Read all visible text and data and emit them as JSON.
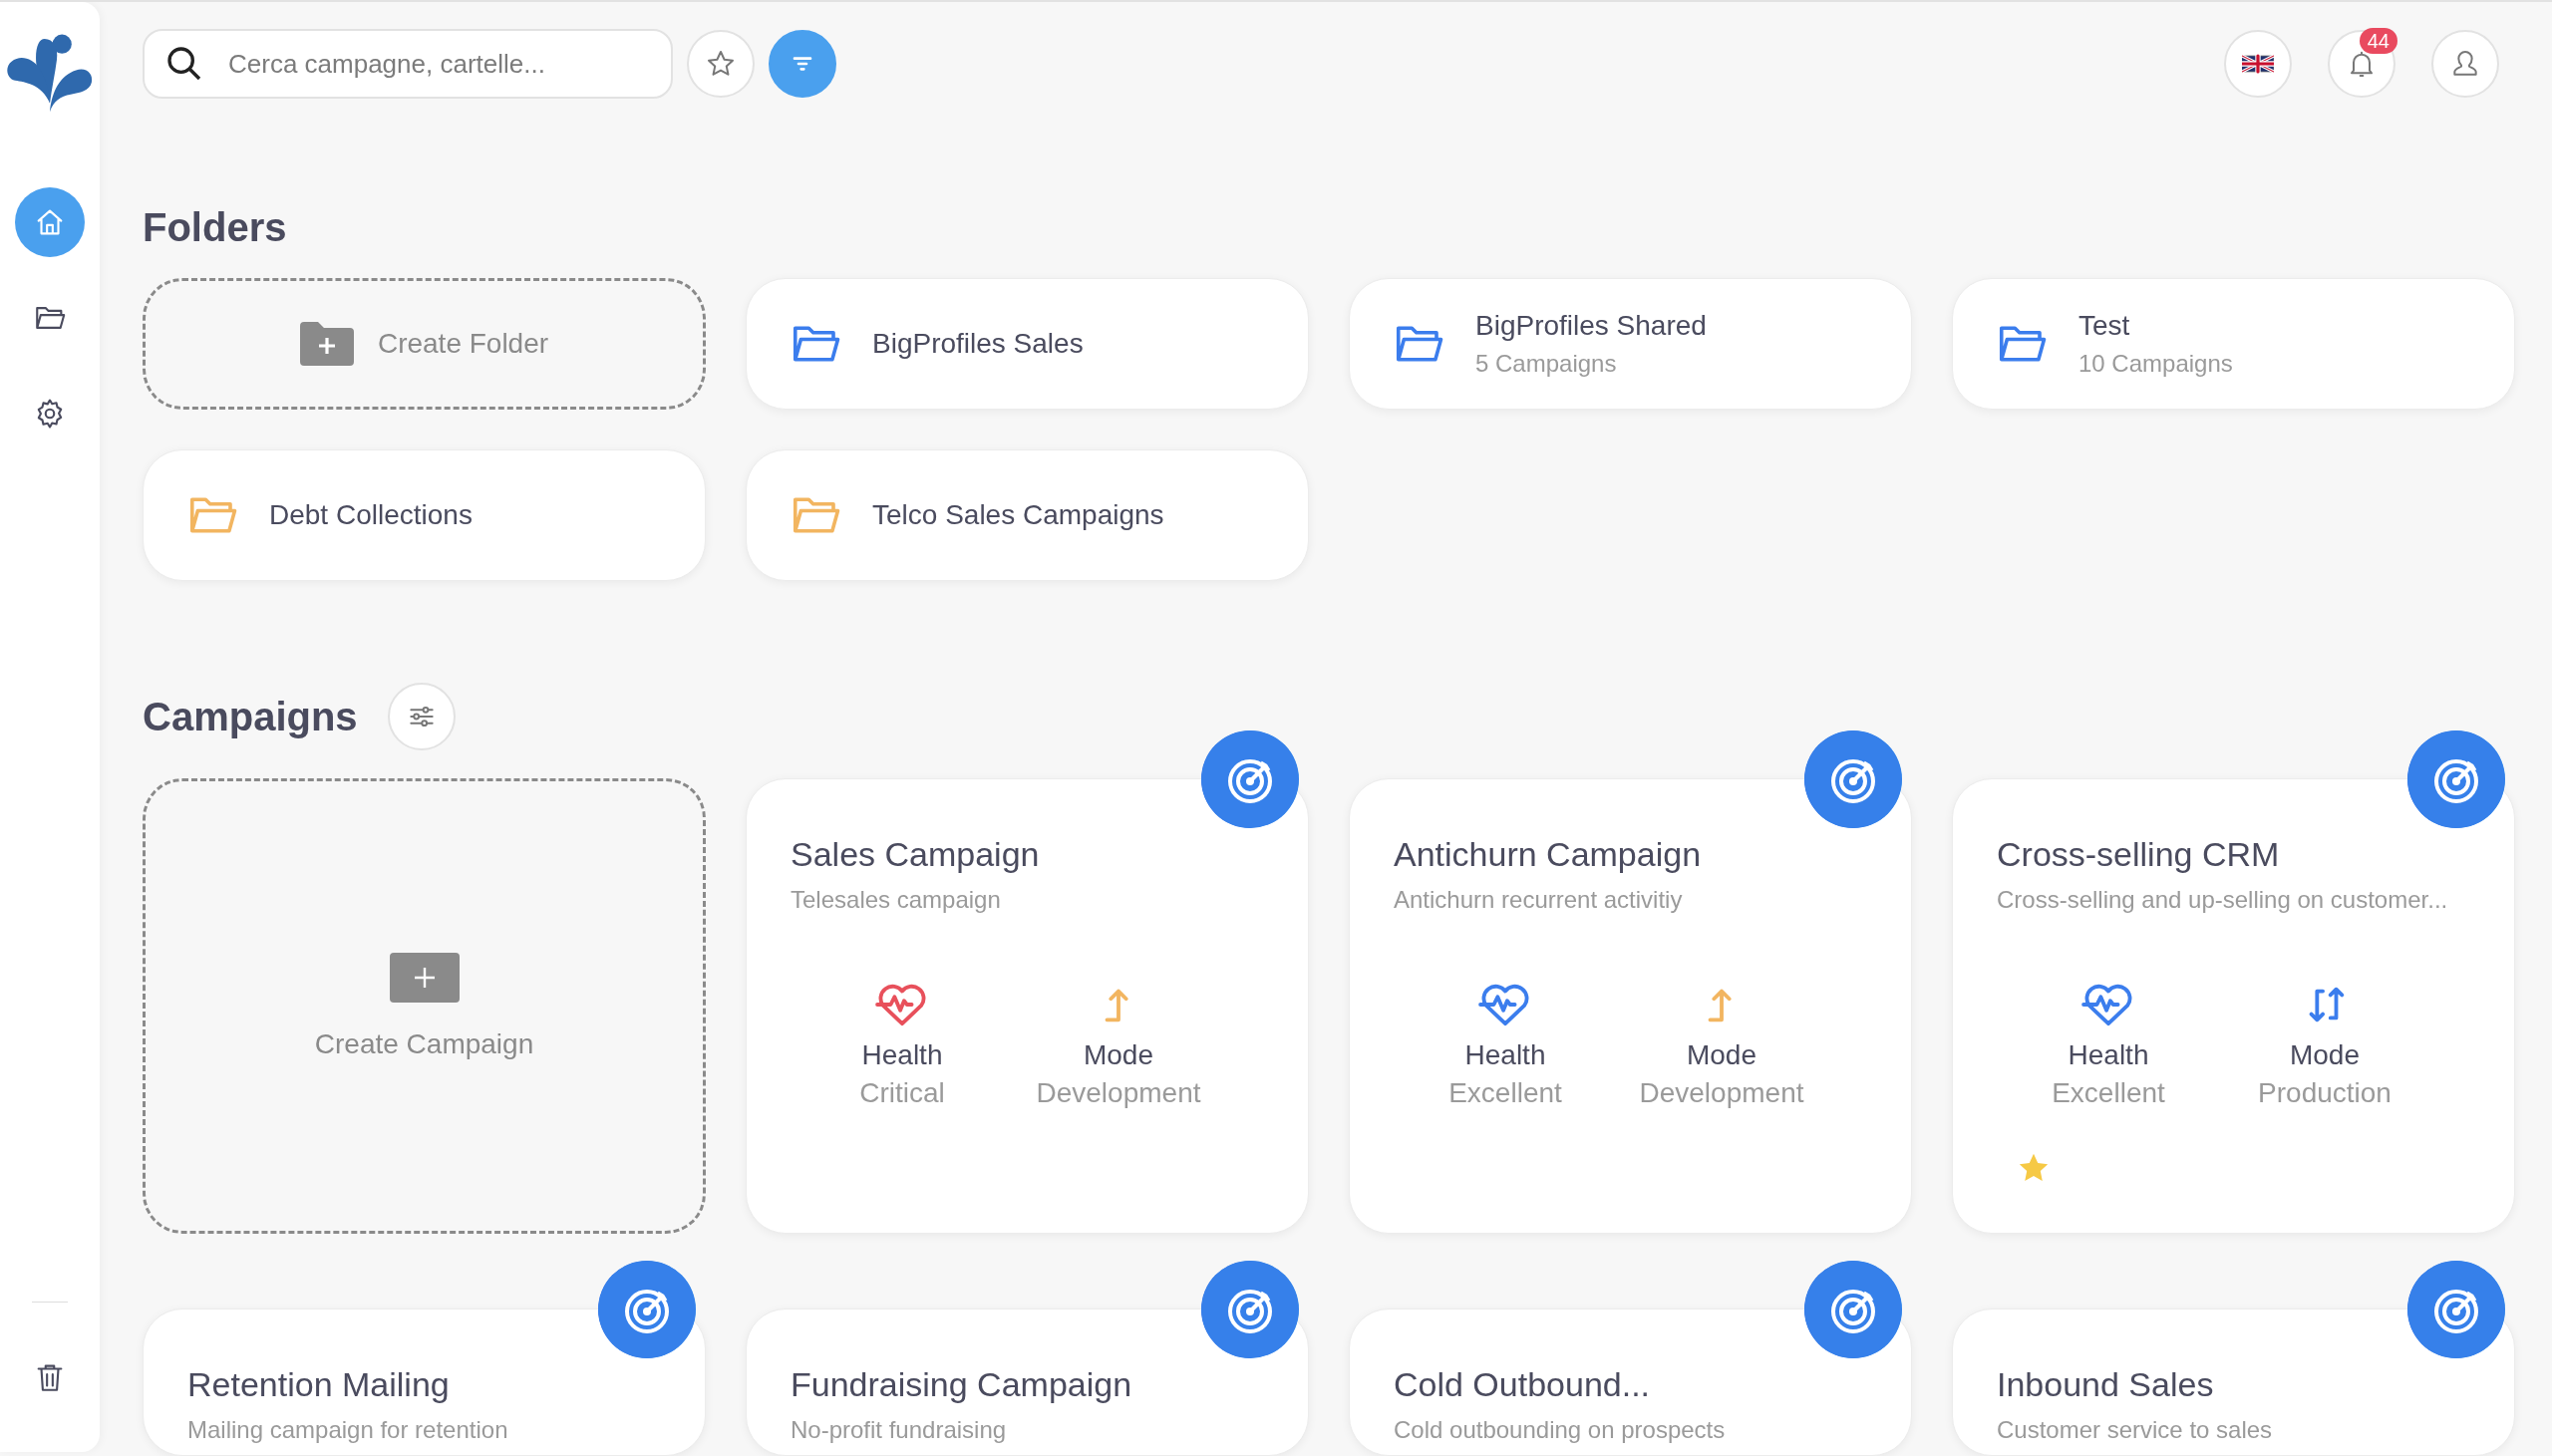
{
  "sidebar": {
    "items": [
      {
        "kind": "home",
        "selected": true
      },
      {
        "kind": "folders",
        "selected": false
      },
      {
        "kind": "settings",
        "selected": false
      },
      {
        "kind": "trash",
        "selected": false
      }
    ]
  },
  "search": {
    "placeholder": "Cerca campagne, cartelle..."
  },
  "toolbar": [
    {
      "kind": "favorites",
      "selected": false
    },
    {
      "kind": "filter",
      "selected": true
    }
  ],
  "header_actions": {
    "notifications_count": "44"
  },
  "folders": {
    "title": "Folders",
    "create_label": "Create Folder",
    "items": [
      {
        "name": "BigProfiles Sales",
        "color": "#3b7ded"
      },
      {
        "name": "BigProfiles Shared",
        "subtitle": "5 Campaigns",
        "color": "#3b7ded"
      },
      {
        "name": "Test",
        "subtitle": "10 Campaigns",
        "color": "#3b7ded"
      },
      {
        "name": "Debt Collections",
        "color": "#f2b560"
      },
      {
        "name": "Telco Sales Campaigns",
        "color": "#f2b560"
      }
    ]
  },
  "campaigns": {
    "title": "Campaigns",
    "create_label": "Create Campaign",
    "items": [
      {
        "name": "Sales Campaign",
        "description": "Telesales campaign",
        "health": {
          "label": "Health",
          "value": "Critical",
          "color": "#e8505b"
        },
        "mode": {
          "label": "Mode",
          "value": "Development",
          "kind": "development"
        },
        "favorite": false
      },
      {
        "name": "Antichurn Campaign",
        "description": "Antichurn recurrent activitiy",
        "health": {
          "label": "Health",
          "value": "Excellent",
          "color": "#3b7ded"
        },
        "mode": {
          "label": "Mode",
          "value": "Development",
          "kind": "development"
        },
        "favorite": false
      },
      {
        "name": "Cross-selling CRM",
        "description": "Cross-selling and up-selling on customer...",
        "health": {
          "label": "Health",
          "value": "Excellent",
          "color": "#3b7ded"
        },
        "mode": {
          "label": "Mode",
          "value": "Production",
          "kind": "production"
        },
        "favorite": true
      },
      {
        "name": "Retention Mailing",
        "description": "Mailing campaign for retention"
      },
      {
        "name": "Fundraising Campaign",
        "description": "No-profit fundraising"
      },
      {
        "name": "Cold Outbound...",
        "description": "Cold outbounding on prospects"
      },
      {
        "name": "Inbound Sales",
        "description": "Customer service to sales"
      }
    ]
  }
}
